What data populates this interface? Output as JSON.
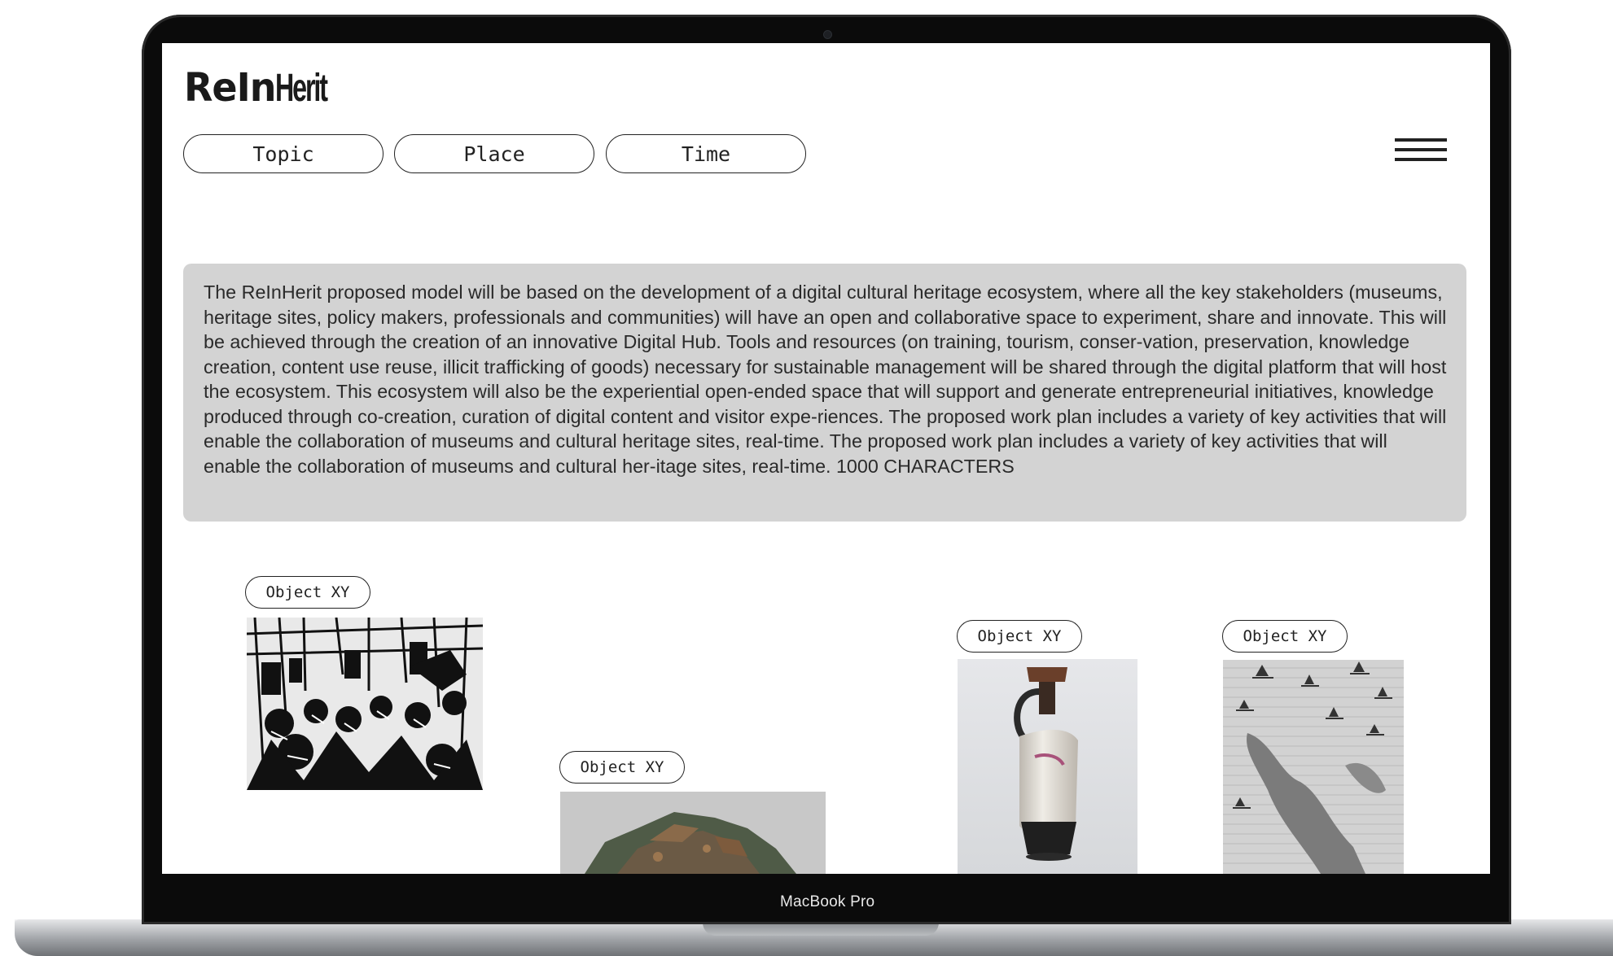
{
  "device": {
    "label": "MacBook Pro"
  },
  "site": {
    "logo_part1": "ReIn",
    "logo_part2": "Herit"
  },
  "nav": {
    "filters": [
      "Topic",
      "Place",
      "Time"
    ]
  },
  "intro": {
    "text": "The ReInHerit proposed model will be based on the development of a digital cultural heritage ecosystem, where all the key stakeholders (museums, heritage sites, policy makers, professionals and communities) will have an open and collaborative space to experiment, share and innovate. This will be achieved through the creation of an innovative Digital Hub. Tools and resources (on training, tourism, conser-vation, preservation, knowledge creation, content use reuse, illicit trafficking of goods) necessary for sustainable management will be shared through the digital platform that will host the ecosystem. This ecosystem will also be the experiential open-ended space that will support and generate entrepreneurial initiatives, knowledge produced through co-creation, curation of digital content and visitor expe-riences. The proposed work plan includes a variety of key activities that will enable the collaboration of museums and cultural heritage sites, real-time. The proposed work plan includes a variety of key activities that will enable the collaboration of museums and cultural her-itage sites, real-time. 1000 CHARACTERS"
  },
  "objects": [
    {
      "label": "Object XY",
      "image": "woodcut-crowd-print"
    },
    {
      "label": "Object XY",
      "image": "sculpted-landscape-model"
    },
    {
      "label": "Object XY",
      "image": "greek-lekythos-vase"
    },
    {
      "label": "Object XY",
      "image": "engraved-sea-map-with-ships"
    }
  ]
}
